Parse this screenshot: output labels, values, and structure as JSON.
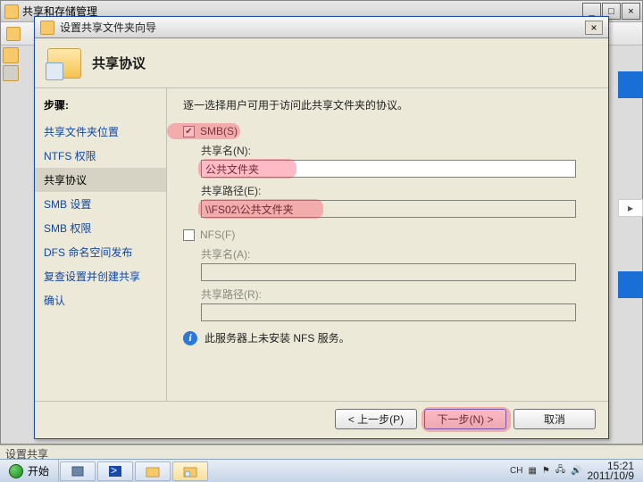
{
  "bg_window_title": "共享和存储管理",
  "wizard": {
    "title": "设置共享文件夹向导",
    "heading": "共享协议",
    "steps_header": "步骤:",
    "steps": [
      {
        "label": "共享文件夹位置",
        "sel": false
      },
      {
        "label": "NTFS 权限",
        "sel": false
      },
      {
        "label": "共享协议",
        "sel": true
      },
      {
        "label": "SMB 设置",
        "sel": false
      },
      {
        "label": "SMB 权限",
        "sel": false
      },
      {
        "label": "DFS 命名空间发布",
        "sel": false
      },
      {
        "label": "复查设置并创建共享",
        "sel": false
      },
      {
        "label": "确认",
        "sel": false
      }
    ],
    "intro": "逐一选择用户可用于访问此共享文件夹的协议。",
    "smb_check_label": "SMB(S)",
    "smb_name_label": "共享名(N):",
    "smb_name_value": "公共文件夹",
    "smb_path_label": "共享路径(E):",
    "smb_path_value": "\\\\FS02\\公共文件夹",
    "nfs_check_label": "NFS(F)",
    "nfs_name_label": "共享名(A):",
    "nfs_name_value": "",
    "nfs_path_label": "共享路径(R):",
    "nfs_path_value": "",
    "info_text": "此服务器上未安装 NFS 服务。",
    "btn_back": "< 上一步(P)",
    "btn_next": "下一步(N) >",
    "btn_cancel": "取消"
  },
  "status_text": "设置共享",
  "taskbar": {
    "start": "开始",
    "ime": "CH",
    "time": "15:21",
    "date": "2011/10/9"
  }
}
